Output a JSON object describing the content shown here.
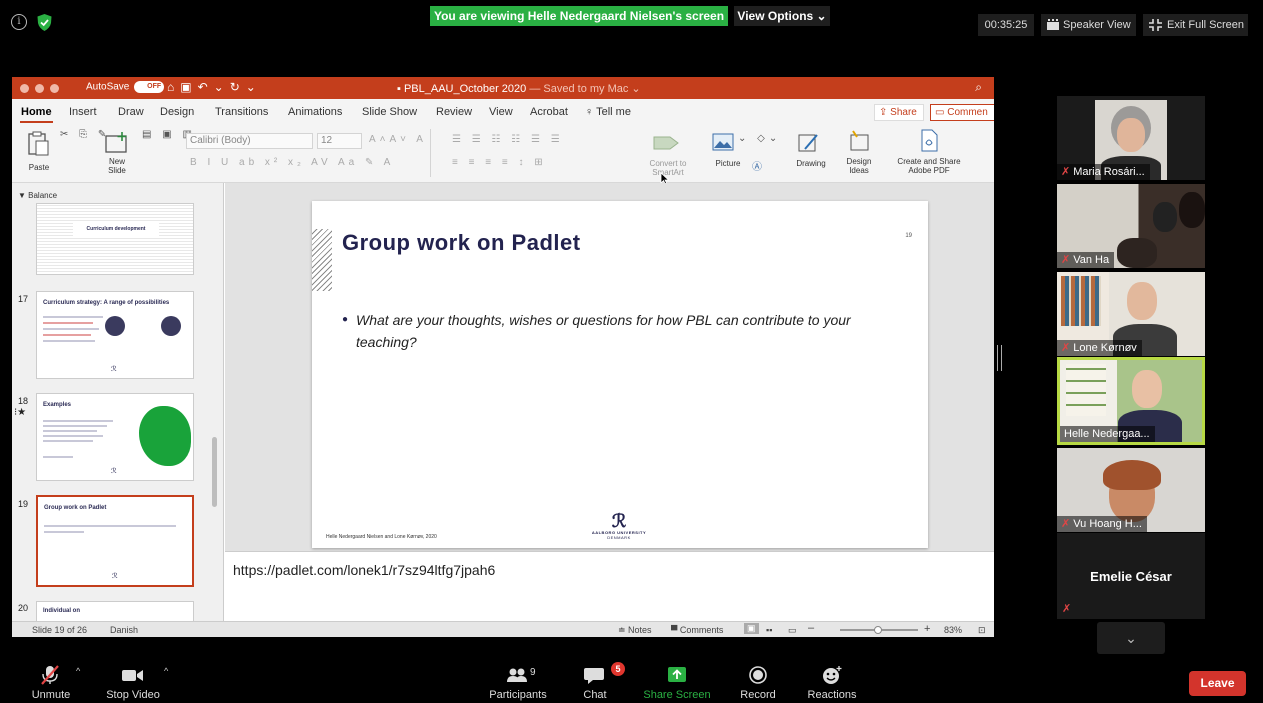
{
  "zoom": {
    "banner": "You are viewing Helle Nedergaard Nielsen's screen",
    "view_options": "View Options ⌄",
    "timer": "00:35:25",
    "speaker_view": "Speaker View",
    "exit_full_screen": "Exit Full Screen",
    "toolbar": {
      "unmute": "Unmute",
      "stop_video": "Stop Video",
      "participants": "Participants",
      "participant_count": "9",
      "chat": "Chat",
      "chat_badge": "5",
      "share_screen": "Share Screen",
      "record": "Record",
      "reactions": "Reactions",
      "leave": "Leave"
    },
    "participants": [
      {
        "name": "Maria Rosári...",
        "muted": true
      },
      {
        "name": "Van Ha",
        "muted": true
      },
      {
        "name": "Lone Kørnøv",
        "muted": true
      },
      {
        "name": "Helle Nedergaa...",
        "muted": false,
        "active": true
      },
      {
        "name": "Vu Hoang H...",
        "muted": true
      },
      {
        "name": "Emelie César",
        "muted": true
      }
    ],
    "colors": {
      "banner_green": "#2ab043",
      "active_border": "#b7d944",
      "leave_red": "#d3342c"
    }
  },
  "ppt": {
    "autosave": "AutoSave",
    "autosave_state": "OFF",
    "filename": "PBL_AAU_October 2020",
    "saved_status": "— Saved to my Mac ⌄",
    "tabs": [
      "Home",
      "Insert",
      "Draw",
      "Design",
      "Transitions",
      "Animations",
      "Slide Show",
      "Review",
      "View",
      "Acrobat",
      "Tell me"
    ],
    "share": "Share",
    "comments": "Commen",
    "ribbon": {
      "paste": "Paste",
      "new_slide": "New Slide",
      "font": "Calibri (Body)",
      "size": "12",
      "convert_smartart": "Convert to SmartArt",
      "picture": "Picture",
      "drawing": "Drawing",
      "design_ideas": "Design Ideas",
      "create_share_pdf": "Create and Share Adobe PDF"
    },
    "section": "Balance",
    "thumbnails": [
      {
        "num": "",
        "title": "Curriculum development"
      },
      {
        "num": "17",
        "title": "Curriculum strategy: A range of possibilities"
      },
      {
        "num": "18",
        "title": "Examples"
      },
      {
        "num": "19",
        "title": "Group work on Padlet"
      },
      {
        "num": "20",
        "title": "Individual on"
      }
    ],
    "slide": {
      "title": "Group work on Padlet",
      "number": "19",
      "bullet": "What are your thoughts, wishes or questions for how PBL can contribute to your teaching?",
      "footer": "Helle Nedergaard Nielsen and Lone Kørnøv, 2020",
      "logo_text": "AALBORG UNIVERSITY",
      "logo_sub": "DENMARK"
    },
    "notes": "https://padlet.com/lonek1/r7sz94ltfg7jpah6",
    "status": {
      "slide_of": "Slide 19 of 26",
      "language": "Danish",
      "notes": "Notes",
      "comments": "Comments",
      "zoom": "83%"
    }
  }
}
